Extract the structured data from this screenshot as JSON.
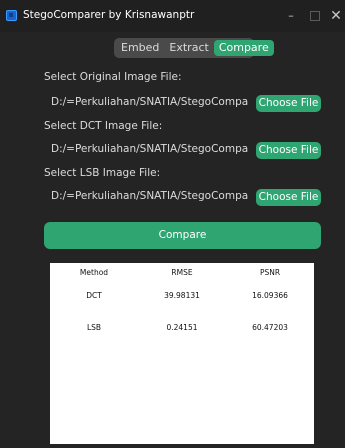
{
  "window": {
    "title": "StegoComparer by Krisnawanptr",
    "minimize": "–",
    "close": "✕"
  },
  "tabs": [
    {
      "label": "Embed",
      "active": false
    },
    {
      "label": "Extract",
      "active": false
    },
    {
      "label": "Compare",
      "active": true
    }
  ],
  "original": {
    "label": "Select Original Image File:",
    "path": "D:/=Perkuliahan/SNATIA/StegoComparer",
    "button": "Choose File"
  },
  "dct": {
    "label": "Select DCT Image File:",
    "path": "D:/=Perkuliahan/SNATIA/StegoComparer",
    "button": "Choose File"
  },
  "lsb": {
    "label": "Select LSB Image File:",
    "path": "D:/=Perkuliahan/SNATIA/StegoComparer",
    "button": "Choose File"
  },
  "compare_button": "Compare",
  "results": {
    "headers": [
      "Method",
      "RMSE",
      "PSNR"
    ],
    "rows": [
      [
        "DCT",
        "39.98131",
        "16.09366"
      ],
      [
        "LSB",
        "0.24151",
        "60.47203"
      ]
    ]
  },
  "colors": {
    "accent": "#2fa572",
    "background": "#242424",
    "titlebar": "#202020"
  }
}
